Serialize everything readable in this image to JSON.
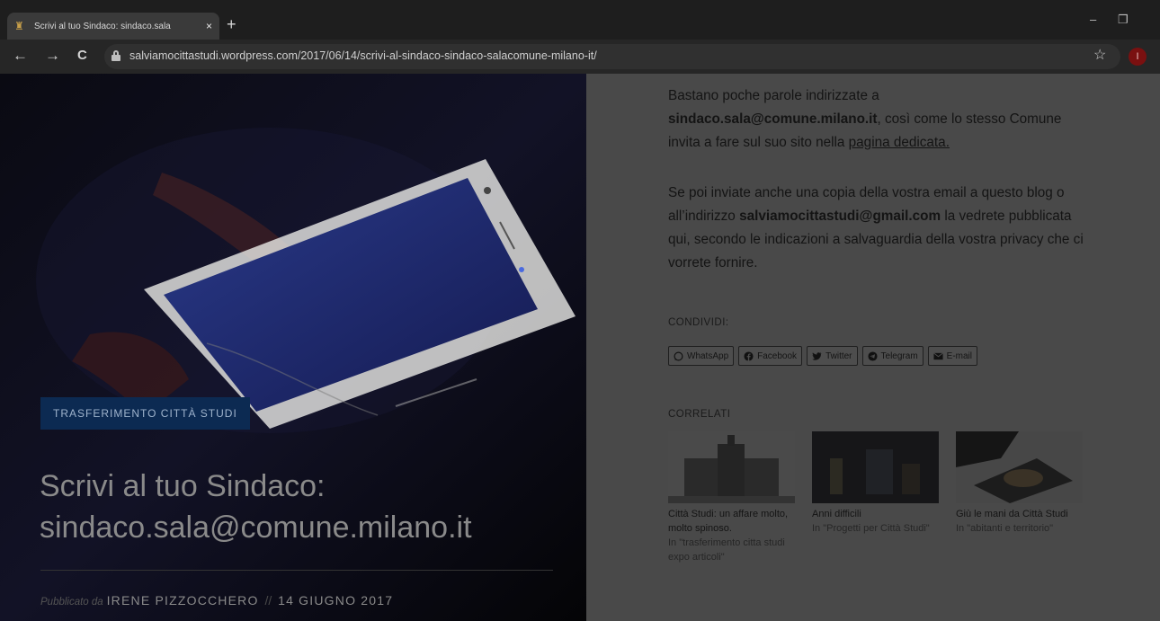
{
  "browser": {
    "tab_title": "Scrivi al tuo Sindaco: sindaco.sala",
    "tab_close": "×",
    "new_tab": "+",
    "url": "salviamocittastudi.wordpress.com/2017/06/14/scrivi-al-sindaco-sindaco-salacomune-milano-it/",
    "back_icon": "←",
    "forward_icon": "→",
    "reload_icon": "C",
    "star_icon": "☆",
    "minimize_icon": "–",
    "restore_icon": "❐",
    "profile_initial": "I"
  },
  "hero": {
    "category": "TRASFERIMENTO CITTÀ STUDI",
    "title_line1": "Scrivi al tuo Sindaco:",
    "title_line2": "sindaco.sala@comune.milano.it",
    "byline_pre": "Pubblicato da",
    "author": "IRENE PIZZOCCHERO",
    "separator": "//",
    "date": "14 GIUGNO 2017"
  },
  "content": {
    "p1_text1": "Bastano poche parole indirizzate a ",
    "p1_email": "sindaco.sala@comune.milano.it",
    "p1_text2": ", così come lo stesso Comune invita a fare sul suo sito nella ",
    "p1_link": "pagina dedicata.",
    "p2_text1": "Se poi inviate anche una copia della vostra email a questo blog o all’indirizzo ",
    "p2_email": "salviamocittastudi@gmail.com",
    "p2_text2": " la vedrete pubblicata qui, secondo le indicazioni a salvaguardia della vostra privacy che ci vorrete fornire.",
    "share_label": "CONDIVIDI:",
    "share_buttons": [
      "WhatsApp",
      "Facebook",
      "Twitter",
      "Telegram",
      "E-mail"
    ],
    "related_label": "CORRELATI",
    "related": [
      {
        "title": "Città Studi: un affare molto, molto spinoso.",
        "category": "In \"trasferimento citta studi expo articoli\""
      },
      {
        "title": "Anni difficili",
        "category": "In \"Progetti per Città Studi\""
      },
      {
        "title": "Giù le mani da Città Studi",
        "category": "In \"abitanti e territorio\""
      }
    ]
  }
}
